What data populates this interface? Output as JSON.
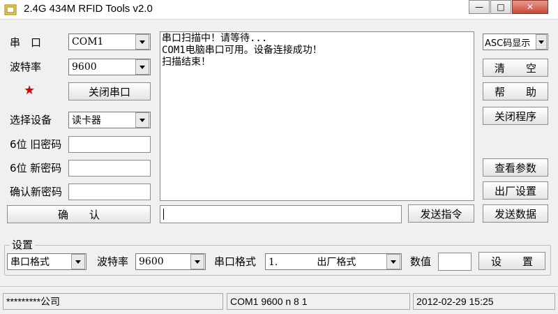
{
  "window": {
    "title": "2.4G 434M RFID Tools v2.0",
    "minimize": "—",
    "maximize": "□",
    "close": "✕"
  },
  "left": {
    "port_label": "串　口",
    "port_value": "COM1",
    "baud_label": "波特率",
    "baud_value": "9600",
    "star": "★",
    "close_port_btn": "关闭串口",
    "device_label": "选择设备",
    "device_value": "读卡器",
    "old_pwd_label": "6位 旧密码",
    "new_pwd_label": "6位 新密码",
    "confirm_pwd_label": "确认新密码",
    "confirm_btn": "确　　认"
  },
  "log": {
    "lines": [
      "串口扫描中！请等待...",
      "COM1电脑串口可用。设备连接成功！",
      "扫描结束！"
    ]
  },
  "right": {
    "display_mode": "ASC码显示",
    "clear_btn": "清　　空",
    "help_btn": "帮　　助",
    "close_program_btn": "关闭程序",
    "view_params_btn": "查看参数",
    "factory_btn": "出厂设置",
    "send_data_btn": "发送数据"
  },
  "command": {
    "input_value": "",
    "send_cmd_btn": "发送指令"
  },
  "settings": {
    "group_label": "设置",
    "format_select": "串口格式",
    "baud_label": "波特率",
    "baud_value": "9600",
    "format_label": "串口格式",
    "format_value": "1.　　　　出厂格式",
    "value_label": "数值",
    "value_input": "",
    "set_btn": "设　　置"
  },
  "statusbar": {
    "company": "*********公司",
    "port_info": "COM1 9600 n 8 1",
    "datetime": "2012-02-29 15:25"
  },
  "colors": {
    "star": "#e00000",
    "window_bg": "#f0f0f0",
    "close_button": "#c9483a"
  },
  "icons": {
    "app": "app-icon",
    "dropdown": "chevron-down-icon"
  }
}
